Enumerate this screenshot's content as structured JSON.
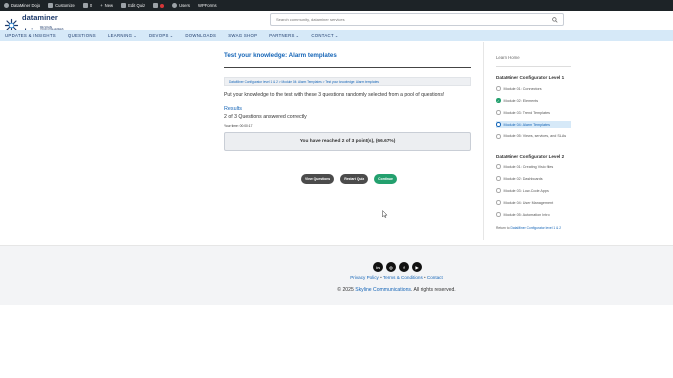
{
  "adminbar": {
    "items": [
      {
        "label": "DataMiner Dojo",
        "icon": "home-icon"
      },
      {
        "label": "Customize",
        "icon": "brush-icon"
      },
      {
        "label": "0",
        "icon": "comment-icon"
      },
      {
        "label": "New",
        "icon": "plus-icon"
      },
      {
        "label": "Edit Quiz",
        "icon": "pencil-icon"
      },
      {
        "label": "Users",
        "icon": "users-icon"
      },
      {
        "label": "WPForms",
        "icon": "wpforms-icon"
      }
    ]
  },
  "header": {
    "logo_line1": "dataminer",
    "logo_line2": "dojo",
    "logo_tag1": "WE SOLVE",
    "logo_tag2": "YOUR CHALLENGES",
    "search_placeholder": "Search community, dataminer services"
  },
  "nav": {
    "items": [
      {
        "label": "Updates & Insights",
        "has_menu": false
      },
      {
        "label": "Questions",
        "has_menu": false
      },
      {
        "label": "Learning",
        "has_menu": true
      },
      {
        "label": "DevOps",
        "has_menu": true
      },
      {
        "label": "Downloads",
        "has_menu": false
      },
      {
        "label": "Swag Shop",
        "has_menu": false
      },
      {
        "label": "Partners",
        "has_menu": true
      },
      {
        "label": "Contact",
        "has_menu": true
      }
    ]
  },
  "main": {
    "title": "Test your knowledge: Alarm templates",
    "breadcrumb": "DataMiner Configurator level 1 & 2 > Module 04: Alarm Templates > Test your knowledge: Alarm templates",
    "intro": "Put your knowledge to the test with these 3 questions randomly selected from a pool of questions!",
    "results_heading": "Results",
    "score_text": "2 of 3 Questions answered correctly",
    "time_text": "Your time: 00:00:17",
    "reached_text": "You have reached 2 of 3 point(s), (66.67%)",
    "buttons": {
      "view": "View Questions",
      "restart": "Restart Quiz",
      "continue": "Continue"
    }
  },
  "sidebar": {
    "home": "Learn Home",
    "level1_title": "DataMiner Configurator Level 1",
    "level1_items": [
      {
        "label": "Module 01: Connectors",
        "state": "open"
      },
      {
        "label": "Module 02: Elements",
        "state": "done"
      },
      {
        "label": "Module 03: Trend Templates",
        "state": "open"
      },
      {
        "label": "Module 04: Alarm Templates",
        "state": "current"
      },
      {
        "label": "Module 05: Views, services, and SLAs",
        "state": "open"
      }
    ],
    "level2_title": "DataMiner Configurator Level 2",
    "level2_items": [
      {
        "label": "Module 01: Creating Visio files",
        "state": "open"
      },
      {
        "label": "Module 02: Dashboards",
        "state": "open"
      },
      {
        "label": "Module 03: Low-Code Apps",
        "state": "open"
      },
      {
        "label": "Module 04: User Management",
        "state": "open"
      },
      {
        "label": "Module 05: Automation Intro",
        "state": "open"
      }
    ],
    "return_prefix": "Return to",
    "return_link": "DataMiner Configurator level 1 & 2"
  },
  "footer": {
    "social": [
      {
        "label": "in",
        "icon": "linkedin-icon"
      },
      {
        "label": "◎",
        "icon": "instagram-icon"
      },
      {
        "label": "f",
        "icon": "facebook-icon"
      },
      {
        "label": "▶",
        "icon": "youtube-icon"
      }
    ],
    "link_privacy": "Privacy Policy",
    "link_terms": "Terms & Conditions",
    "link_contact": "Contact",
    "sep": "•",
    "copy_prefix": "© 2025",
    "copy_company": "Skyline Communications",
    "copy_suffix": ". All rights reserved."
  }
}
